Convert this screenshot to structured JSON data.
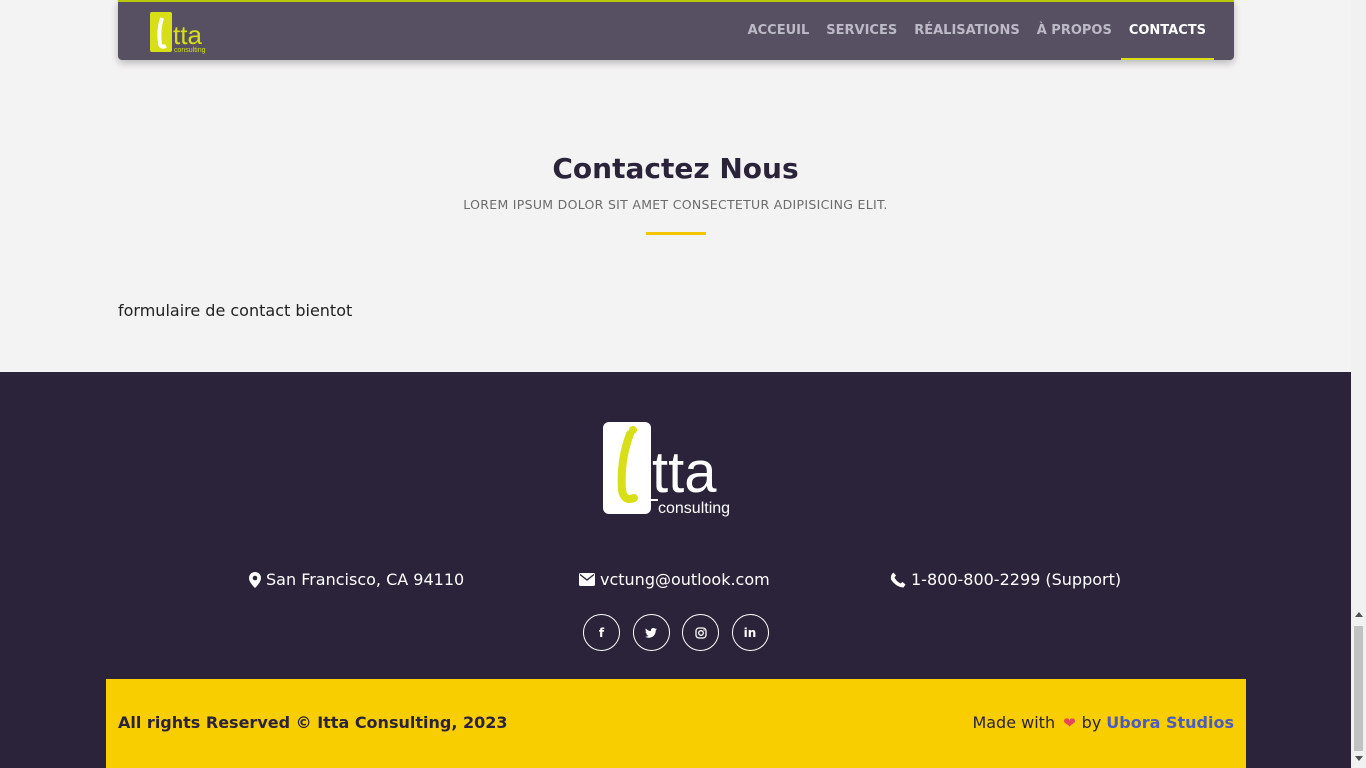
{
  "brand": {
    "logo_text": "itta",
    "logo_sub": "consulting",
    "accent": "#d8df17"
  },
  "nav": {
    "items": [
      {
        "label": "ACCEUIL"
      },
      {
        "label": "SERVICES"
      },
      {
        "label": "RÉALISATIONS"
      },
      {
        "label": "À PROPOS"
      },
      {
        "label": "CONTACTS"
      }
    ],
    "active": "CONTACTS"
  },
  "section": {
    "title": "Contactez Nous",
    "subtitle": "LOREM IPSUM DOLOR SIT AMET CONSECTETUR ADIPISICING ELIT.",
    "body": "formulaire de contact bientot"
  },
  "footer": {
    "address": "San Francisco, CA 94110",
    "email": "vctung@outlook.com",
    "phone": "1-800-800-2299 (Support)",
    "socials": [
      {
        "icon": "facebook-icon",
        "glyph": "f"
      },
      {
        "icon": "twitter-icon",
        "glyph": "t"
      },
      {
        "icon": "instagram-icon",
        "glyph": "◎"
      },
      {
        "icon": "linkedin-icon",
        "glyph": "in"
      }
    ],
    "copyright": "All rights Reserved © Itta Consulting, 2023",
    "made_with": "Made with",
    "heart": "❤",
    "by": "by",
    "studio": "Ubora Studios"
  },
  "colors": {
    "footer_bg": "#2a2339",
    "copyright_bg": "#f9ce00",
    "studio_link": "#4a5bc2"
  }
}
